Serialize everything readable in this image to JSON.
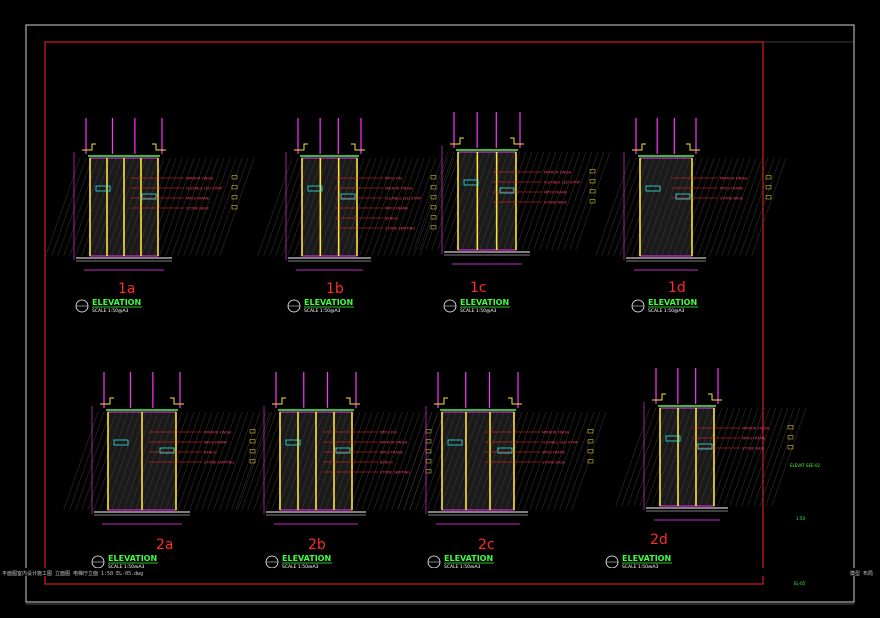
{
  "drawing": {
    "elevations": [
      {
        "id": "1a",
        "label": "1a",
        "title": "ELEVATION",
        "scale": "SCALE 1:50@A3",
        "notes": [
          "MIRROR FINISH",
          "FLEXIBLE LED STRIP",
          "MP03 FRAME",
          "STONE BASE"
        ]
      },
      {
        "id": "1b",
        "label": "1b",
        "title": "ELEVATION",
        "scale": "SCALE 1:50@A3",
        "notes": [
          "MP03 FIN",
          "MIRROR FINISH",
          "FLEXIBLE LED STRIP",
          "MP03 FRAME",
          "BENCH",
          "STONE SKIRTING"
        ]
      },
      {
        "id": "1c",
        "label": "1c",
        "title": "ELEVATION",
        "scale": "SCALE 1:50@A3",
        "notes": [
          "MIRROR FINISH",
          "FLEXIBLE LED STRIP",
          "MP03 FRAME",
          "STONE BASE"
        ]
      },
      {
        "id": "1d",
        "label": "1d",
        "title": "ELEVATION",
        "scale": "SCALE 1:50@A3",
        "notes": [
          "MIRROR FINISH",
          "MP03 FRAME",
          "STONE BASE"
        ]
      },
      {
        "id": "2a",
        "label": "2a",
        "title": "ELEVATION",
        "scale": "SCALE 1:50@A3",
        "notes": [
          "MIRROR FINISH",
          "MP03 FRAME",
          "BENCH",
          "STONE SKIRTING"
        ]
      },
      {
        "id": "2b",
        "label": "2b",
        "title": "ELEVATION",
        "scale": "SCALE 1:50@A3",
        "notes": [
          "MP03 FIN",
          "MIRROR FINISH",
          "MP03 FRAME",
          "BENCH",
          "STONE SKIRTING"
        ]
      },
      {
        "id": "2c",
        "label": "2c",
        "title": "ELEVATION",
        "scale": "SCALE 1:50@A3",
        "notes": [
          "MIRROR FINISH",
          "FLEXIBLE LED STRIP",
          "MP03 FRAME",
          "STONE BASE"
        ]
      },
      {
        "id": "2d",
        "label": "2d",
        "title": "ELEVATION",
        "scale": "SCALE 1:50@A3",
        "notes": [
          "MIRROR FINISH",
          "MP03 FRAME",
          "STONE BASE"
        ]
      }
    ],
    "side_note": "ELEVAT SEE-02",
    "side_scale": "1:50",
    "sheet_no": "EL-05",
    "status_bar": "平面图室内设计施工图 立面图 电梯厅立面 1:50 EL-05.dwg",
    "status_right": "模型 布局"
  },
  "colors": {
    "background": "#000000",
    "frame": "#ff2020",
    "green": "#3dff3d",
    "yellow": "#ffe23a",
    "magenta": "#ff34ff",
    "red": "#ff2b2b",
    "cyan": "#33e6e6",
    "white": "#ffffff"
  }
}
